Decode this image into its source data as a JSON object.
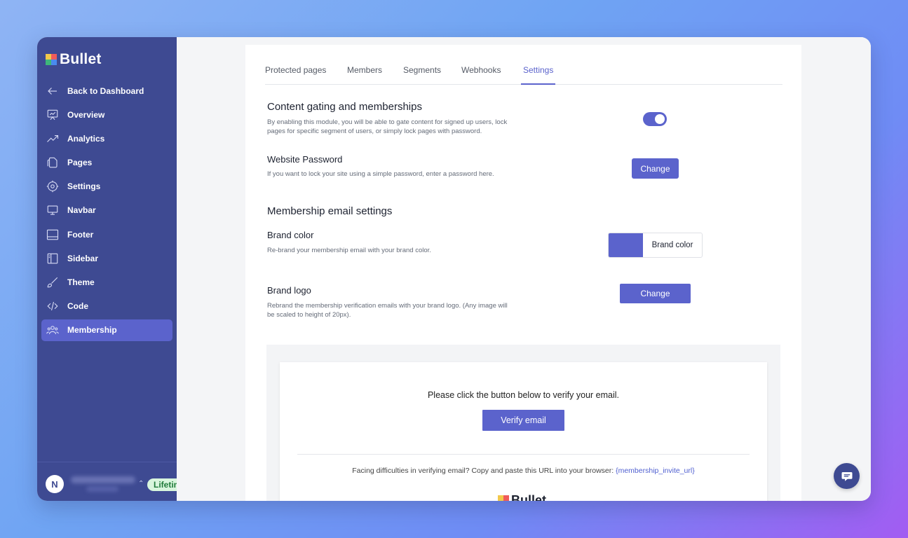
{
  "app": {
    "name": "Bullet"
  },
  "sidebar": {
    "items": [
      {
        "label": "Back to Dashboard",
        "icon": "arrow-left-icon"
      },
      {
        "label": "Overview",
        "icon": "presentation-chart-icon"
      },
      {
        "label": "Analytics",
        "icon": "trend-up-icon"
      },
      {
        "label": "Pages",
        "icon": "pages-icon"
      },
      {
        "label": "Settings",
        "icon": "gear-icon"
      },
      {
        "label": "Navbar",
        "icon": "monitor-icon"
      },
      {
        "label": "Footer",
        "icon": "footer-layout-icon"
      },
      {
        "label": "Sidebar",
        "icon": "sidebar-layout-icon"
      },
      {
        "label": "Theme",
        "icon": "paintbrush-icon"
      },
      {
        "label": "Code",
        "icon": "code-icon"
      },
      {
        "label": "Membership",
        "icon": "users-icon",
        "active": true
      }
    ],
    "user": {
      "initial": "N",
      "plan_badge": "Lifetime"
    }
  },
  "tabs": [
    {
      "label": "Protected pages"
    },
    {
      "label": "Members"
    },
    {
      "label": "Segments"
    },
    {
      "label": "Webhooks"
    },
    {
      "label": "Settings",
      "active": true
    }
  ],
  "content_gating": {
    "title": "Content gating and memberships",
    "description": "By enabling this module, you will be able to gate content for signed up users, lock pages for specific segment of users, or simply lock pages with password.",
    "enabled": true
  },
  "website_password": {
    "title": "Website Password",
    "description": "If you want to lock your site using a simple password, enter a password here.",
    "button": "Change"
  },
  "membership_email": {
    "title": "Membership email settings",
    "brand_color": {
      "title": "Brand color",
      "description": "Re-brand your membership email with your brand color.",
      "picker_label": "Brand color",
      "value": "#5b63cc"
    },
    "brand_logo": {
      "title": "Brand logo",
      "description": "Rebrand the membership verification emails with your brand logo. (Any image will be scaled to height of 20px).",
      "button": "Change"
    }
  },
  "email_preview": {
    "message": "Please click the button below to verify your email.",
    "button": "Verify email",
    "footer_text": "Facing difficulties in verifying email? Copy and paste this URL into your browser: ",
    "footer_link": "{membership_invite_url}",
    "logo_text": "Bullet"
  },
  "colors": {
    "sidebar_bg": "#3e4a92",
    "accent": "#5b63cc",
    "badge_bg": "#d8f5dd",
    "badge_text": "#1f7a3a"
  }
}
